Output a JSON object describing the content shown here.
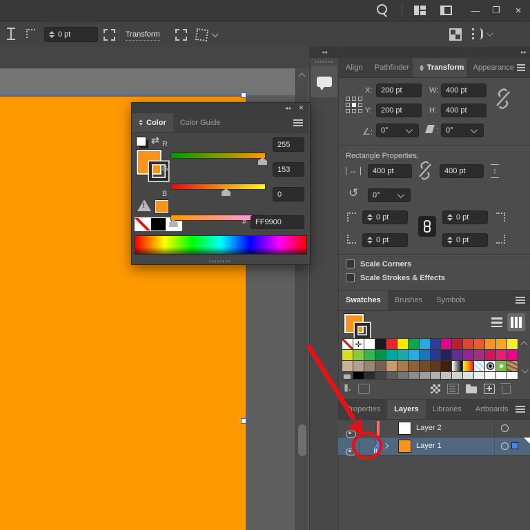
{
  "window": {
    "controls": {
      "minimize": "—",
      "restore": "❐",
      "close": "×"
    }
  },
  "control_bar": {
    "offset_value": "0 pt",
    "transform_link_label": "Transform"
  },
  "dock": {
    "collapse_left": "◂◂",
    "collapse_right": "▸▸"
  },
  "color_panel": {
    "collapse": "◂◂",
    "close": "×",
    "tabs": [
      {
        "label": "Color"
      },
      {
        "label": "Color Guide"
      }
    ],
    "sliders": [
      {
        "label": "R",
        "value": "255",
        "pos": 0.97,
        "track": "linear-gradient(90deg,#009900,#ff9900)"
      },
      {
        "label": "G",
        "value": "153",
        "pos": 0.58,
        "track": "linear-gradient(90deg,#ff0000,#ffff00)"
      },
      {
        "label": "B",
        "value": "0",
        "pos": 0.02,
        "track": "linear-gradient(90deg,#ff9900,#ff99ff)"
      }
    ],
    "hex_label": "#",
    "hex_value": "FF9900"
  },
  "transform_panel": {
    "tabs": [
      "Align",
      "Pathfinder",
      "Transform",
      "Appearance"
    ],
    "menu": "panel-menu",
    "x_label": "X:",
    "x_value": "200 pt",
    "y_label": "Y:",
    "y_value": "200 pt",
    "w_label": "W:",
    "w_value": "400 pt",
    "h_label": "H:",
    "h_value": "400 pt",
    "rotate_value": "0°",
    "shear_value": "0°",
    "rect_title": "Rectangle Properties:",
    "rect_width": "400 pt",
    "rect_height": "400 pt",
    "rect_angle": "0°",
    "corners": [
      "0 pt",
      "0 pt",
      "0 pt",
      "0 pt"
    ],
    "checkbox1": "Scale Corners",
    "checkbox2": "Scale Strokes & Effects"
  },
  "swatches_panel": {
    "tabs": [
      "Swatches",
      "Brushes",
      "Symbols"
    ],
    "grid": [
      [
        "none",
        "registration",
        "#FFFFFF",
        "#1B1B1B",
        "#E8242C",
        "#FFE800",
        "#0DA64E",
        "#28A9E0",
        "#333B9E",
        "#E5038C",
        "#BE1E2D",
        "#E2452D",
        "#F05A28",
        "#F6921E",
        "#F8A51F",
        "#F9ED32"
      ],
      [
        "#D7DF23",
        "#8DC63F",
        "#39B54A",
        "#00944D",
        "#00A79D",
        "#1CA8A8",
        "#27AAE1",
        "#1C75BC",
        "#2B3990",
        "#262262",
        "#662D91",
        "#92278F",
        "#A32E83",
        "#D4145A",
        "#EA1D76",
        "#EC008C"
      ],
      [
        "#C7B299",
        "#B2A18C",
        "#998675",
        "#736357",
        "#C69C6E",
        "#A97C50",
        "#8B6239",
        "#754C29",
        "#5E3A1C",
        "#42210B",
        "grad-bw",
        "grad-fire",
        "pat-blue",
        "pat-dot",
        "pat-green",
        "pat-wood"
      ],
      [
        "folder",
        "#000000",
        "#2B2B2B",
        "#444444",
        "#5C5C5C",
        "#757575",
        "#8C8C8C",
        "#9E9E9E",
        "#B0B0B0",
        "#C1C1C1",
        "#D1D1D1",
        "#E0E0E0",
        "#EDEDED",
        "#F7F7F7",
        "#FCFCFC",
        "#FFFFFF"
      ]
    ]
  },
  "layers_panel": {
    "tabs": [
      "Properties",
      "Layers",
      "Libraries",
      "Artboards"
    ],
    "rows": [
      {
        "name": "Layer 2",
        "thumb": "#FFFFFF",
        "bar": "#F46E65",
        "locked": false
      },
      {
        "name": "Layer 1",
        "thumb": "#F7941D",
        "bar": "#4F7DF3",
        "locked": true
      }
    ]
  },
  "colors": {
    "artwork_orange": "#FF9900",
    "selection_blue": "#4A6CB3",
    "annotation_red": "#E01418",
    "layer_selected_bg": "#50687F"
  }
}
